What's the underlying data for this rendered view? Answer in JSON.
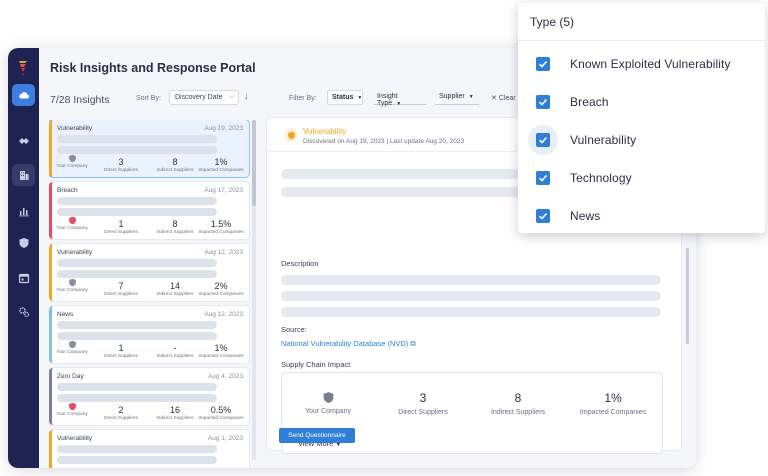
{
  "header": {
    "title": "Risk Insights and Response Portal"
  },
  "toolbar": {
    "count": "7/28 Insights",
    "sort_label": "Sort By:",
    "sort_value": "Discovery Date",
    "filter_label": "Filter By:",
    "filter_status": "Status",
    "filter_insight_type": "Insight Type",
    "filter_supplier": "Supplier",
    "clear": "Clear"
  },
  "stat_labels": {
    "company": "Your Company",
    "direct": "Direct Suppliers",
    "indirect": "Indirect Suppliers",
    "impacted": "Impacted Companies"
  },
  "insights": [
    {
      "type": "Vulnerability",
      "date": "Aug 19, 2023",
      "direct": "3",
      "indirect": "8",
      "impacted": "1%",
      "color": "#f5a623",
      "shield": "#8a8f9e"
    },
    {
      "type": "Breach",
      "date": "Aug 17, 2023",
      "direct": "1",
      "indirect": "8",
      "impacted": "1.5%",
      "color": "#e84a5f",
      "shield": "#e84a5f"
    },
    {
      "type": "Vulnerability",
      "date": "Aug 12, 2023",
      "direct": "7",
      "indirect": "14",
      "impacted": "2%",
      "color": "#f5a623",
      "shield": "#8a8f9e"
    },
    {
      "type": "News",
      "date": "Aug 12, 2023",
      "direct": "1",
      "indirect": "-",
      "impacted": "1%",
      "color": "#7fc0ef",
      "shield": "#8a8f9e"
    },
    {
      "type": "Zero Day",
      "date": "Aug 4, 2023",
      "direct": "2",
      "indirect": "16",
      "impacted": "0.5%",
      "color": "#7a7f99",
      "shield": "#e84a5f"
    },
    {
      "type": "Vulnerability",
      "date": "Aug 1, 2023",
      "color": "#f5a623"
    }
  ],
  "detail": {
    "type": "Vulnerability",
    "meta": "Discovered on Aug 19, 2023  |  Last update Aug 20, 2023",
    "description_label": "Description",
    "source_label": "Source:",
    "source_link": "National Vulnerability Database (NVD)",
    "impact_label": "Supply Chain Impact",
    "impact": {
      "company": "Your Company",
      "direct_value": "3",
      "direct_label": "Direct Suppliers",
      "indirect_value": "8",
      "indirect_label": "Indirect Suppliers",
      "impacted_value": "1%",
      "impacted_label": "Impacted Companies"
    },
    "view_more": "View More",
    "send_button": "Send Questionnaire"
  },
  "type_filter": {
    "title": "Type (5)",
    "options": [
      "Known Exploited Vulnerability",
      "Breach",
      "Vulnerability",
      "Technology",
      "News"
    ]
  },
  "colors": {
    "sidebar": "#1e2352",
    "accent": "#2f7fd6",
    "vulnerability": "#f5a623",
    "breach": "#e84a5f"
  }
}
